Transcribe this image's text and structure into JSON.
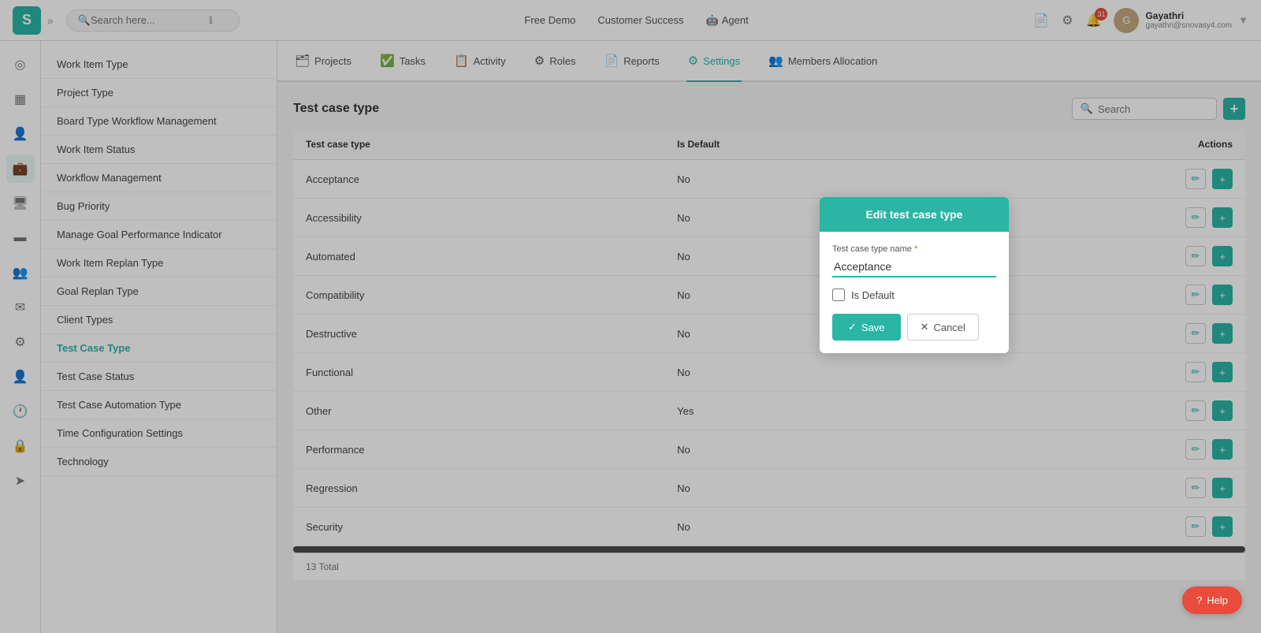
{
  "app": {
    "logo": "S",
    "search_placeholder": "Search here...",
    "top_nav_items": [
      {
        "label": "Free Demo"
      },
      {
        "label": "Customer Success"
      },
      {
        "label": "Agent"
      }
    ],
    "user": {
      "name": "Gayathri",
      "email": "gayathri@snovasy4.com",
      "avatar_initials": "G"
    }
  },
  "tabs": [
    {
      "label": "Projects",
      "icon": "🗂"
    },
    {
      "label": "Tasks",
      "icon": "✅"
    },
    {
      "label": "Activity",
      "icon": "📋"
    },
    {
      "label": "Roles",
      "icon": "⚙"
    },
    {
      "label": "Reports",
      "icon": "📄"
    },
    {
      "label": "Settings",
      "icon": "⚙",
      "active": true
    },
    {
      "label": "Members Allocation",
      "icon": "👥"
    }
  ],
  "sidebar_icons": [
    {
      "name": "dashboard-icon",
      "symbol": "◎",
      "active": false
    },
    {
      "name": "calendar-icon",
      "symbol": "📅",
      "active": false
    },
    {
      "name": "person-icon",
      "symbol": "👤",
      "active": false
    },
    {
      "name": "briefcase-icon",
      "symbol": "💼",
      "active": true
    },
    {
      "name": "monitor-icon",
      "symbol": "🖥",
      "active": false
    },
    {
      "name": "card-icon",
      "symbol": "💳",
      "active": false
    },
    {
      "name": "team-icon",
      "symbol": "👥",
      "active": false
    },
    {
      "name": "mail-icon",
      "symbol": "✉",
      "active": false
    },
    {
      "name": "gear-icon",
      "symbol": "⚙",
      "active": false
    },
    {
      "name": "user-settings-icon",
      "symbol": "👤",
      "active": false
    },
    {
      "name": "clock-icon",
      "symbol": "🕐",
      "active": false
    },
    {
      "name": "lock-icon",
      "symbol": "🔒",
      "active": false
    },
    {
      "name": "send-icon",
      "symbol": "➤",
      "active": false
    }
  ],
  "secondary_sidebar": {
    "items": [
      {
        "label": "Work Item Type",
        "active": false
      },
      {
        "label": "Project Type",
        "active": false
      },
      {
        "label": "Board Type Workflow Management",
        "active": false
      },
      {
        "label": "Work Item Status",
        "active": false
      },
      {
        "label": "Workflow Management",
        "active": false
      },
      {
        "label": "Bug Priority",
        "active": false
      },
      {
        "label": "Manage Goal Performance Indicator",
        "active": false
      },
      {
        "label": "Work Item Replan Type",
        "active": false
      },
      {
        "label": "Goal Replan Type",
        "active": false
      },
      {
        "label": "Client Types",
        "active": false
      },
      {
        "label": "Test Case Type",
        "active": true
      },
      {
        "label": "Test Case Status",
        "active": false
      },
      {
        "label": "Test Case Automation Type",
        "active": false
      },
      {
        "label": "Time Configuration Settings",
        "active": false
      },
      {
        "label": "Technology",
        "active": false
      }
    ]
  },
  "main": {
    "page_title": "Test case type",
    "search_placeholder": "Search",
    "add_button_label": "+",
    "table": {
      "columns": [
        "Test case type",
        "Is Default",
        "Actions"
      ],
      "rows": [
        {
          "type": "Acceptance",
          "is_default": "No"
        },
        {
          "type": "Accessibility",
          "is_default": "No"
        },
        {
          "type": "Automated",
          "is_default": "No"
        },
        {
          "type": "Compatibility",
          "is_default": "No"
        },
        {
          "type": "Destructive",
          "is_default": "No"
        },
        {
          "type": "Functional",
          "is_default": "No"
        },
        {
          "type": "Other",
          "is_default": "Yes"
        },
        {
          "type": "Performance",
          "is_default": "No"
        },
        {
          "type": "Regression",
          "is_default": "No"
        },
        {
          "type": "Security",
          "is_default": "No"
        }
      ],
      "total": "13 Total"
    }
  },
  "modal": {
    "title": "Edit test case type",
    "field_label": "Test case type name",
    "field_value": "Acceptance",
    "is_default_label": "Is Default",
    "save_label": "Save",
    "cancel_label": "Cancel"
  },
  "help_button": {
    "label": "Help",
    "icon": "?"
  }
}
